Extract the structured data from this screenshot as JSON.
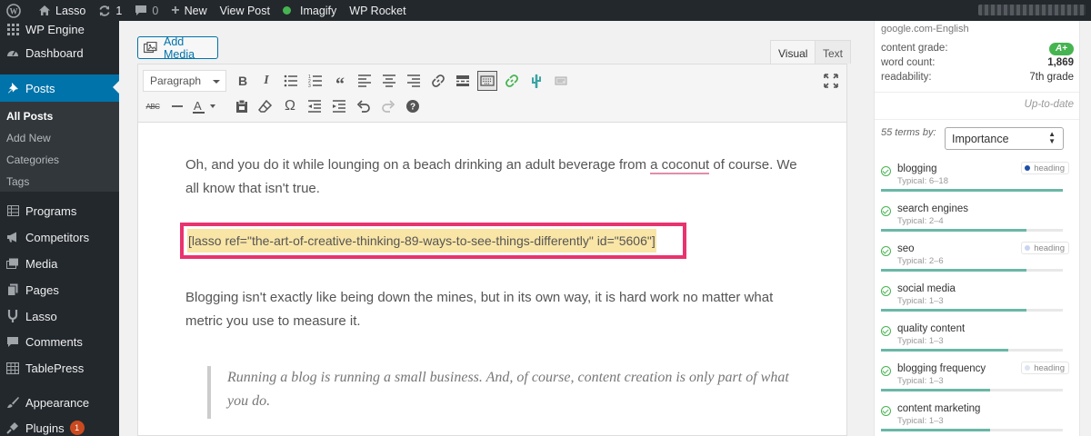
{
  "adminbar": {
    "site_name": "Lasso",
    "updates_count": "1",
    "comments_count": "0",
    "new_label": "New",
    "view_post_label": "View Post",
    "imagify_label": "Imagify",
    "rocket_label": "WP Rocket",
    "status_color": "#46b450"
  },
  "sidebar": {
    "items": [
      {
        "label": "WP Engine",
        "icon": "grid-icon"
      },
      {
        "label": "Dashboard",
        "icon": "gauge-icon"
      },
      {
        "label": "Posts",
        "icon": "pin-icon"
      },
      {
        "label": "Programs",
        "icon": "table-icon"
      },
      {
        "label": "Competitors",
        "icon": "megaphone-icon"
      },
      {
        "label": "Media",
        "icon": "media-icon"
      },
      {
        "label": "Pages",
        "icon": "pages-icon"
      },
      {
        "label": "Lasso",
        "icon": "lasso-icon"
      },
      {
        "label": "Comments",
        "icon": "comment-icon"
      },
      {
        "label": "TablePress",
        "icon": "tablepress-icon"
      },
      {
        "label": "Appearance",
        "icon": "brush-icon"
      },
      {
        "label": "Plugins",
        "icon": "plug-icon"
      }
    ],
    "submenu": [
      "All Posts",
      "Add New",
      "Categories",
      "Tags"
    ],
    "plugins_badge": "1",
    "active_color": "#0073aa"
  },
  "editor": {
    "add_media_label": "Add Media",
    "tab_visual": "Visual",
    "tab_text": "Text",
    "format_value": "Paragraph",
    "paragraph1_before": "Oh, and you do it while lounging on a beach drinking an adult beverage from ",
    "paragraph1_misspelled": "a coconut",
    "paragraph1_after": " of course. We all know that isn't true.",
    "shortcode": "[lasso ref=\"the-art-of-creative-thinking-89-ways-to-see-things-differently\" id=\"5606\"]",
    "paragraph2": "Blogging isn't exactly like being down the mines, but in its own way, it is hard work no matter what metric you use to measure it.",
    "quote": "Running a blog is running a small business. And, of course, content creation is only part of what you do.",
    "highlight_color": "#e8336e"
  },
  "seo_panel": {
    "domain": "google.com-English",
    "content_grade_label": "content grade:",
    "content_grade_value": "A+",
    "word_count_label": "word count:",
    "word_count_value": "1,869",
    "readability_label": "readability:",
    "readability_value": "7th grade",
    "status": "Up-to-date",
    "terms_count_label": "55 terms by:",
    "sort_value": "Importance",
    "terms": [
      {
        "name": "blogging",
        "typical": "Typical: 6–18",
        "badge": "heading",
        "badge_dot": "#1e4fa8",
        "fill": 1.0
      },
      {
        "name": "search engines",
        "typical": "Typical: 2–4",
        "badge": "",
        "badge_dot": "",
        "fill": 0.8
      },
      {
        "name": "seo",
        "typical": "Typical: 2–6",
        "badge": "heading",
        "badge_dot": "#c9d4f0",
        "fill": 0.8
      },
      {
        "name": "social media",
        "typical": "Typical: 1–3",
        "badge": "",
        "badge_dot": "",
        "fill": 0.8
      },
      {
        "name": "quality content",
        "typical": "Typical: 1–3",
        "badge": "",
        "badge_dot": "",
        "fill": 0.7
      },
      {
        "name": "blogging frequency",
        "typical": "Typical: 1–3",
        "badge": "heading",
        "badge_dot": "#dde5f2",
        "fill": 0.6
      },
      {
        "name": "content marketing",
        "typical": "Typical: 1–3",
        "badge": "",
        "badge_dot": "",
        "fill": 0.6
      }
    ]
  }
}
